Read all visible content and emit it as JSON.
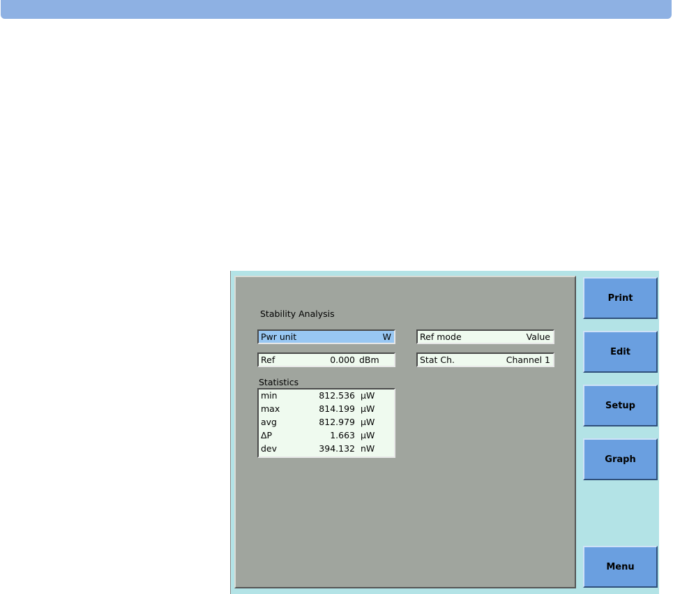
{
  "panel": {
    "title": "Stability Analysis",
    "pwr_unit": {
      "label": "Pwr unit",
      "value": "W"
    },
    "ref_mode": {
      "label": "Ref mode",
      "value": "Value"
    },
    "ref": {
      "label": "Ref",
      "value": "0.000",
      "unit": "dBm"
    },
    "stat_ch": {
      "label": "Stat Ch.",
      "value": "Channel 1"
    },
    "statistics_label": "Statistics",
    "statistics": [
      {
        "name": "min",
        "value": "812.536",
        "unit": "μW"
      },
      {
        "name": "max",
        "value": "814.199",
        "unit": "μW"
      },
      {
        "name": "avg",
        "value": "812.979",
        "unit": "μW"
      },
      {
        "name": "ΔP",
        "value": "1.663",
        "unit": "μW"
      },
      {
        "name": "dev",
        "value": "394.132",
        "unit": "nW"
      }
    ]
  },
  "softkeys": {
    "print": "Print",
    "edit": "Edit",
    "setup": "Setup",
    "graph": "Graph",
    "menu": "Menu"
  }
}
